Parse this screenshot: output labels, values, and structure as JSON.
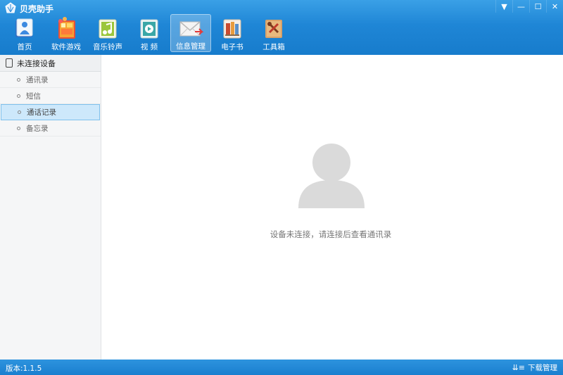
{
  "app": {
    "title": "贝壳助手"
  },
  "window_controls": [
    {
      "name": "menu-dropdown-button",
      "icon": "▼"
    },
    {
      "name": "minimize-button",
      "icon": "—"
    },
    {
      "name": "maximize-button",
      "icon": "☐"
    },
    {
      "name": "close-button",
      "icon": "✕"
    }
  ],
  "toolbar": {
    "items": [
      {
        "label": "首页",
        "icon": "home-icon"
      },
      {
        "label": "软件游戏",
        "icon": "apps-games-icon"
      },
      {
        "label": "音乐铃声",
        "icon": "music-ringtone-icon"
      },
      {
        "label": "视  频",
        "icon": "video-icon"
      },
      {
        "label": "信息管理",
        "icon": "message-envelope-icon",
        "active": true
      },
      {
        "label": "电子书",
        "icon": "ebook-icon"
      },
      {
        "label": "工具箱",
        "icon": "toolbox-icon"
      }
    ]
  },
  "sidebar": {
    "device_label": "未连接设备",
    "items": [
      {
        "label": "通讯录"
      },
      {
        "label": "短信"
      },
      {
        "label": "通话记录",
        "active": true
      },
      {
        "label": "备忘录"
      }
    ]
  },
  "main": {
    "empty_message": "设备未连接，请连接后查看通讯录"
  },
  "statusbar": {
    "version": "版本:1.1.5",
    "download_label": "下载管理"
  },
  "colors": {
    "header_blue": "#1f86d6",
    "active_item_bg": "#cde8fb",
    "avatar_gray": "#d9d9d9"
  }
}
